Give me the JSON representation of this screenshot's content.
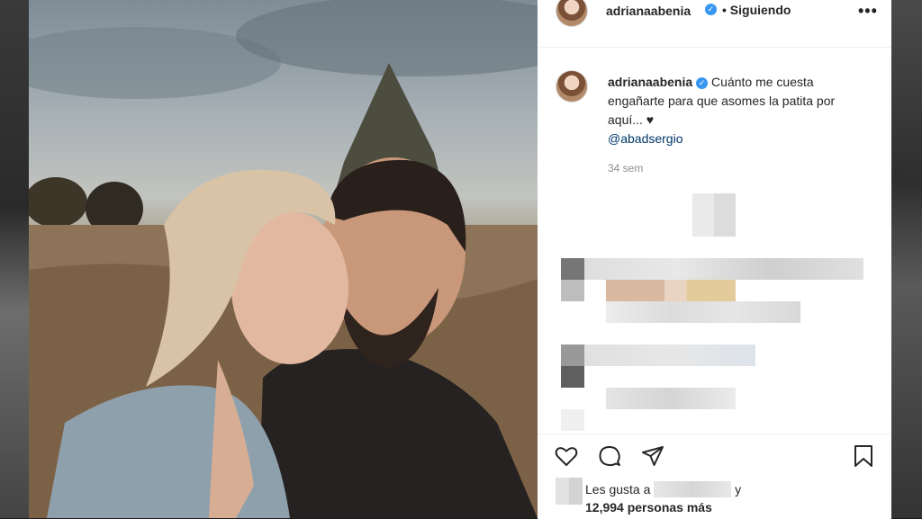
{
  "post": {
    "username": "adrianaabenia",
    "verified_glyph": "✓",
    "follow_state": "• Siguiendo",
    "more_glyph": "•••"
  },
  "caption": {
    "username": "adrianaabenia",
    "text": "Cuánto me cuesta engañarte para que asomes la patita por aquí... ♥",
    "mention": "@abadsergio",
    "time": "34 sem"
  },
  "likes": {
    "prefix": "Les gusta a",
    "suffix": "y",
    "count_text": "12,994 personas más"
  },
  "icons": {
    "like": "heart-icon",
    "comment": "comment-icon",
    "share": "paper-plane-icon",
    "save": "bookmark-icon",
    "more": "more-options-icon",
    "verified": "verified-badge-icon"
  },
  "colors": {
    "verified_blue": "#3897f0",
    "mention": "#00376b",
    "muted": "#8e8e8e",
    "text": "#262626"
  }
}
